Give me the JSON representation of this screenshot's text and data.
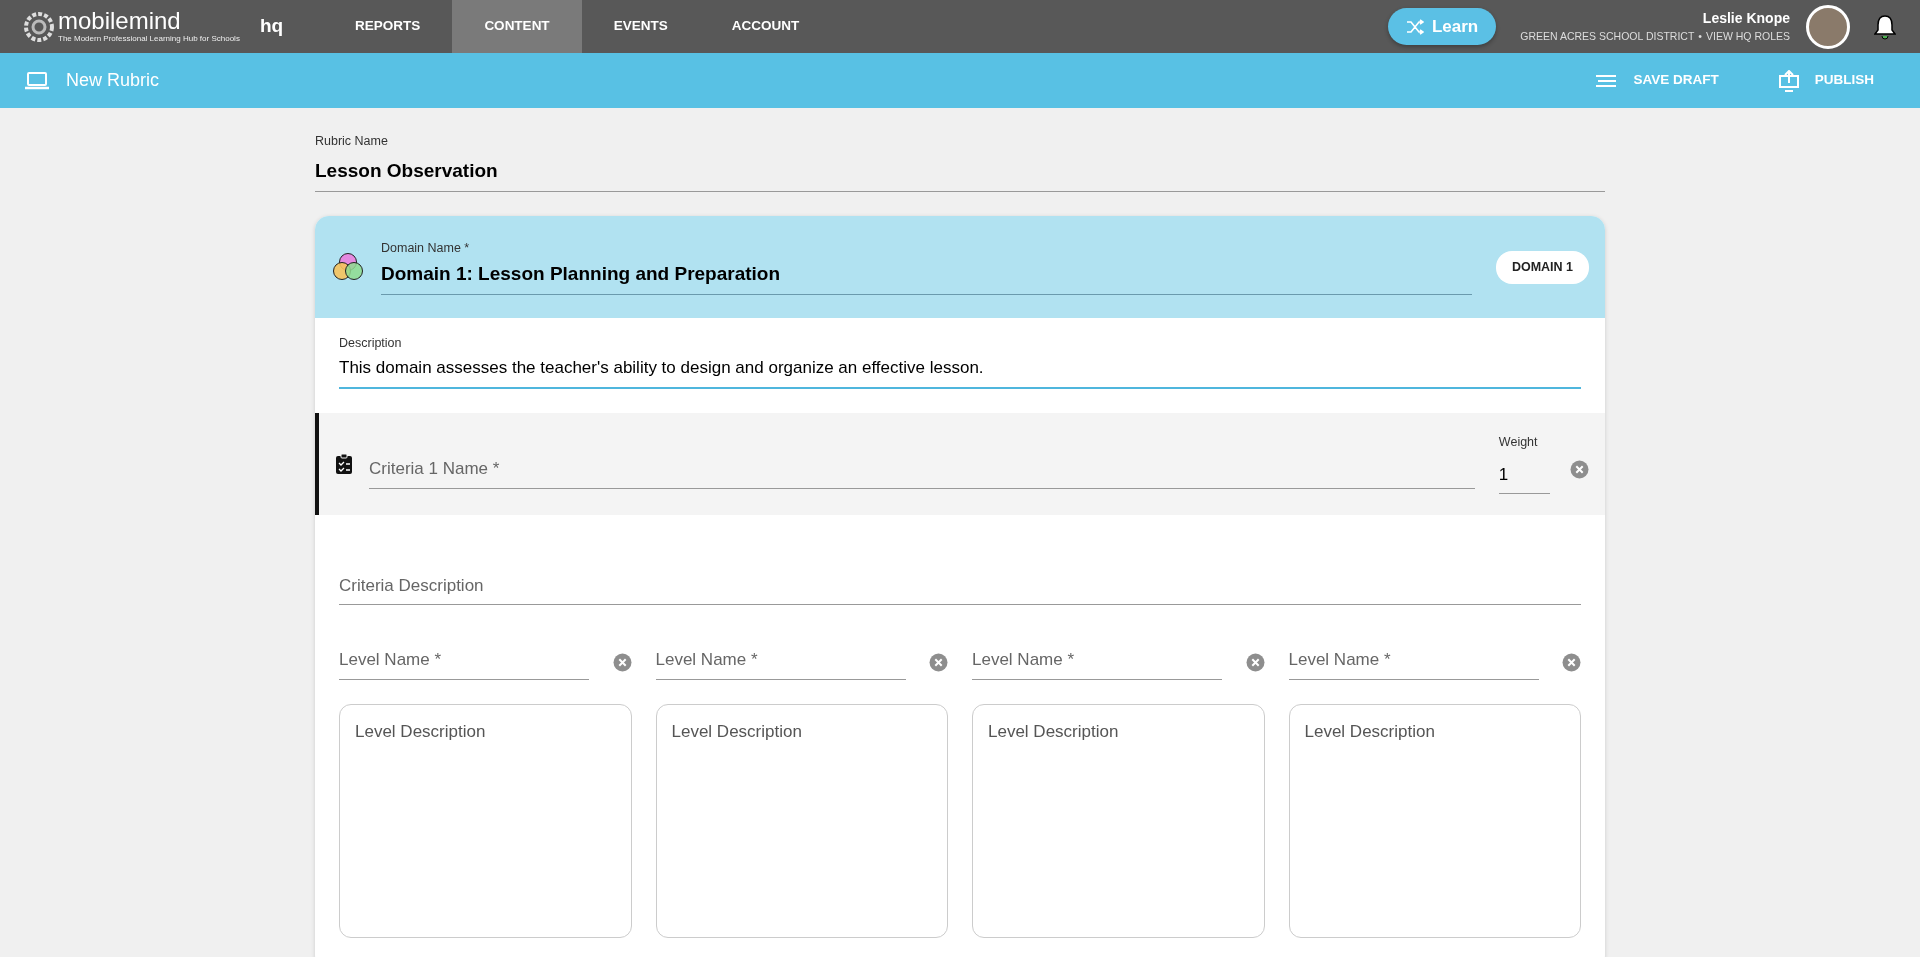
{
  "nav": {
    "logo": "mobilemind",
    "tagline": "The Modern Professional Learning Hub for Schools",
    "product": "hq",
    "tabs": [
      {
        "label": "REPORTS",
        "selected": false
      },
      {
        "label": "CONTENT",
        "selected": true
      },
      {
        "label": "EVENTS",
        "selected": false
      },
      {
        "label": "ACCOUNT",
        "selected": false
      }
    ],
    "learn_button": "Learn",
    "user_name": "Leslie Knope",
    "district": "GREEN ACRES SCHOOL DISTRICT",
    "separator": "•",
    "roles_link": "VIEW HQ ROLES"
  },
  "toolbar": {
    "title": "New Rubric",
    "actions": [
      {
        "label": "SAVE DRAFT",
        "kind": "save"
      },
      {
        "label": "PUBLISH",
        "kind": "publish"
      }
    ]
  },
  "rubric_name": {
    "label": "Rubric Name",
    "value": "Lesson Observation"
  },
  "domain": {
    "label": "Domain Name *",
    "value": "Domain 1: Lesson Planning and Preparation",
    "badge": "DOMAIN 1",
    "description": {
      "label": "Description",
      "value": "This domain assesses the teacher's ability to design and organize an effective lesson."
    },
    "criteria": {
      "placeholder": "Criteria 1 Name *",
      "weight_label": "Weight",
      "weight_value": "1",
      "description_placeholder": "Criteria Description",
      "levels": [
        {
          "name_placeholder": "Level Name *",
          "description_placeholder": "Level Description"
        },
        {
          "name_placeholder": "Level Name *",
          "description_placeholder": "Level Description"
        },
        {
          "name_placeholder": "Level Name *",
          "description_placeholder": "Level Description"
        },
        {
          "name_placeholder": "Level Name *",
          "description_placeholder": "Level Description"
        }
      ]
    }
  }
}
